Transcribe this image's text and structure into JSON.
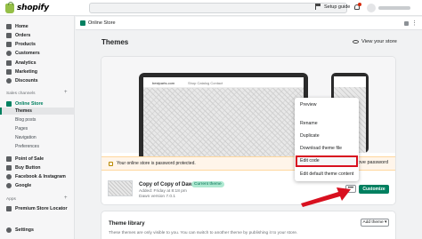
{
  "brand": {
    "name": "shopify"
  },
  "topbar": {
    "setup_guide": "Setup guide"
  },
  "sidebar": {
    "main_items": [
      {
        "label": "Home",
        "icon": "home-icon"
      },
      {
        "label": "Orders",
        "icon": "orders-icon"
      },
      {
        "label": "Products",
        "icon": "tag-icon"
      },
      {
        "label": "Customers",
        "icon": "person-icon"
      },
      {
        "label": "Analytics",
        "icon": "chart-icon"
      },
      {
        "label": "Marketing",
        "icon": "megaphone-icon"
      },
      {
        "label": "Discounts",
        "icon": "discount-icon"
      }
    ],
    "sales_channels_label": "Sales channels",
    "online_store": "Online Store",
    "online_store_sub": [
      "Themes",
      "Blog posts",
      "Pages",
      "Navigation",
      "Preferences"
    ],
    "channels": [
      {
        "label": "Point of Sale",
        "icon": "pos-icon"
      },
      {
        "label": "Buy Button",
        "icon": "buy-button-icon"
      },
      {
        "label": "Facebook & Instagram",
        "icon": "facebook-icon"
      },
      {
        "label": "Google",
        "icon": "google-icon"
      }
    ],
    "apps_label": "Apps",
    "apps": [
      {
        "label": "Premium Store Locator",
        "icon": "app-icon"
      }
    ],
    "settings": "Settings"
  },
  "breadcrumb": {
    "label": "Online Store"
  },
  "page": {
    "title": "Themes",
    "view_store": "View your store"
  },
  "preview": {
    "site_name": "bestparts.com",
    "site_links": "Shop   Catalog   Contact"
  },
  "banner": {
    "text": "Your online store is password protected.",
    "action": "Remove password"
  },
  "current_theme": {
    "name": "Copy of Copy of Dawn",
    "badge": "Current theme",
    "added": "Added: Friday at 8:18 pm",
    "version": "Dawn version 7.0.1",
    "more": "•••",
    "customize": "Customize"
  },
  "menu": {
    "items": [
      "Preview",
      "Rename",
      "Duplicate",
      "Download theme file",
      "Edit code",
      "Edit default theme content"
    ],
    "highlighted": "Edit code"
  },
  "annotation": {
    "color": "#d8101f"
  },
  "library": {
    "title": "Theme library",
    "add_theme": "Add theme ▾",
    "description": "These themes are only visible to you. You can switch to another theme by publishing it to your store."
  },
  "colors": {
    "primary": "#008060",
    "brand": "#95bf47",
    "badge_bg": "#aee9d1",
    "banner_bg": "#fff5ea"
  }
}
